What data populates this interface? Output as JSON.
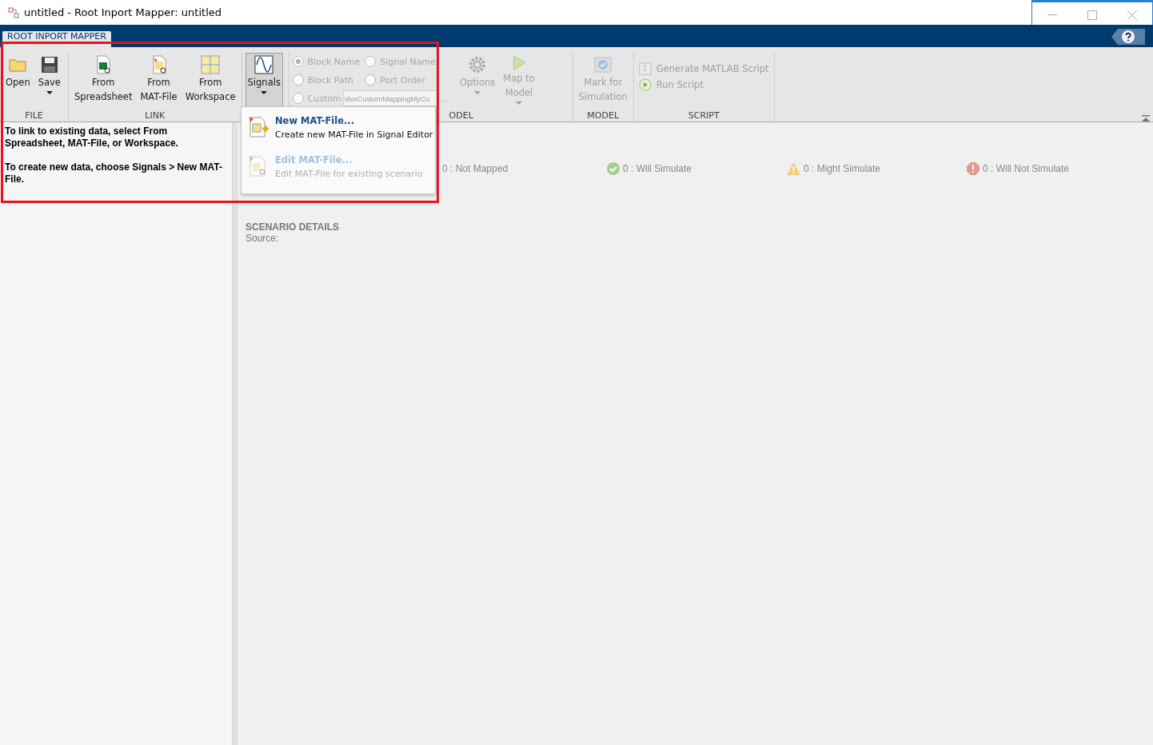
{
  "window": {
    "title": "untitled - Root Inport Mapper: untitled"
  },
  "tabs": [
    {
      "label": "ROOT INPORT MAPPER",
      "selected": true
    }
  ],
  "ribbon": {
    "file": {
      "label": "FILE",
      "buttons": [
        {
          "kind": "folder",
          "lines": [
            "Open"
          ],
          "dropdown": false,
          "disabled": false
        },
        {
          "kind": "disk",
          "lines": [
            "Save"
          ],
          "dropdown": true,
          "disabled": false
        }
      ]
    },
    "link": {
      "label": "LINK",
      "buttons": [
        {
          "kind": "spreadsheet",
          "lines": [
            "From",
            "Spreadsheet"
          ],
          "dropdown": false,
          "disabled": false
        },
        {
          "kind": "matfile",
          "lines": [
            "From",
            "MAT-File"
          ],
          "dropdown": false,
          "disabled": false
        },
        {
          "kind": "workspace",
          "lines": [
            "From",
            "Workspace"
          ],
          "dropdown": false,
          "disabled": false
        }
      ]
    },
    "signals": {
      "buttons": [
        {
          "kind": "signals",
          "lines": [
            "Signals"
          ],
          "dropdown": true,
          "disabled": false,
          "expanded": true
        }
      ]
    },
    "mapping": {
      "label": "ODEL",
      "radios": [
        {
          "label": "Block Name",
          "selected": true,
          "disabled": true
        },
        {
          "label": "Signal Name",
          "selected": false,
          "disabled": true
        },
        {
          "label": "Block Path",
          "selected": false,
          "disabled": true
        },
        {
          "label": "Port Order",
          "selected": false,
          "disabled": true
        },
        {
          "label": "Custom",
          "selected": false,
          "disabled": true
        }
      ],
      "custom_value": "slexCustomMappingMyCu",
      "browse": "...",
      "buttons": [
        {
          "kind": "gear",
          "lines": [
            "Options"
          ],
          "dropdown": true,
          "disabled": true
        },
        {
          "kind": "play",
          "lines": [
            "Map to",
            "Model"
          ],
          "dropdown": true,
          "disabled": true
        }
      ]
    },
    "model": {
      "label": "MODEL",
      "buttons": [
        {
          "kind": "check",
          "lines": [
            "Mark for",
            "Simulation"
          ],
          "dropdown": false,
          "disabled": true
        }
      ]
    },
    "script": {
      "label": "SCRIPT",
      "items": [
        {
          "kind": "script",
          "label": "Generate MATLAB Script",
          "disabled": true
        },
        {
          "kind": "run",
          "label": "Run Script",
          "disabled": true
        }
      ]
    }
  },
  "signals_menu": {
    "items": [
      {
        "kind": "new",
        "title": "New MAT-File...",
        "description": "Create new MAT-File in Signal Editor",
        "disabled": false
      },
      {
        "kind": "edit",
        "title": "Edit MAT-File...",
        "description": "Edit MAT-File for existing scenario",
        "disabled": true
      }
    ]
  },
  "left_panel": {
    "paragraphs": [
      "To link to existing data, select From Spreadsheet, MAT-File, or Workspace.",
      "To create new data, choose Signals > New MAT-File."
    ]
  },
  "status": [
    {
      "kind": "none",
      "text": "0 : Not Mapped"
    },
    {
      "kind": "ok",
      "text": "0 : Will Simulate"
    },
    {
      "kind": "warn",
      "text": "0 : Might Simulate"
    },
    {
      "kind": "error",
      "text": "0 : Will Not Simulate"
    }
  ],
  "details": {
    "heading": "SCENARIO DETAILS",
    "source": "Source:"
  },
  "highlight_box": true
}
